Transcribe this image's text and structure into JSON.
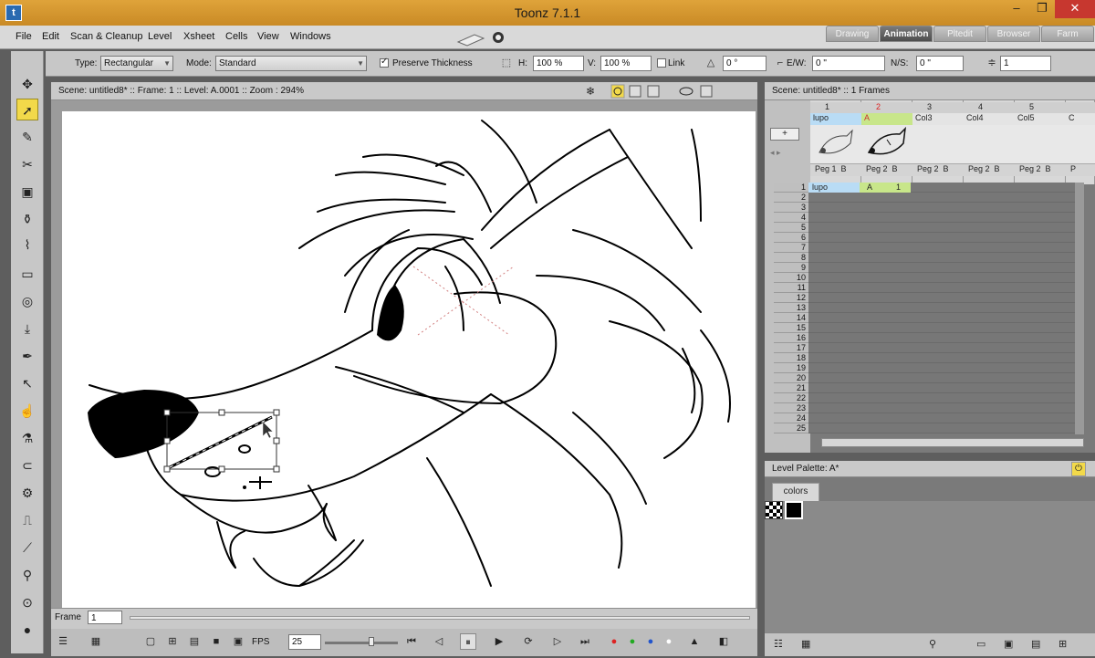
{
  "window": {
    "title": "Toonz 7.1.1",
    "minimize": "–",
    "maximize": "❐",
    "close": "✕"
  },
  "menu": [
    "File",
    "Edit",
    "Scan & Cleanup",
    "Level",
    "Xsheet",
    "Cells",
    "View",
    "Windows"
  ],
  "rooms": {
    "tabs": [
      "Drawing",
      "Animation",
      "Pltedit",
      "Browser",
      "Farm"
    ],
    "active": "Animation"
  },
  "tool_options": {
    "type_label": "Type:",
    "type_value": "Rectangular",
    "mode_label": "Mode:",
    "mode_value": "Standard",
    "preserve_thickness_label": "Preserve Thickness",
    "preserve_thickness_checked": true,
    "h_label": "H:",
    "h_value": "100 %",
    "v_label": "V:",
    "v_value": "100 %",
    "link_label": "Link",
    "angle_value": "0 °",
    "ew_label": "E/W:",
    "ew_value": "0 \"",
    "ns_label": "N/S:",
    "ns_value": "0 \"",
    "thickness_value": "1"
  },
  "viewer": {
    "header_text": "Scene: untitled8*  ::  Frame: 1  ::  Level: A.0001  ::  Zoom : 294%",
    "frame_label": "Frame",
    "frame_value": "1",
    "fps_label": "FPS",
    "fps_value": "25"
  },
  "xsheet": {
    "header_text": "Scene: untitled8*  ::  1 Frames",
    "columns": [
      {
        "num": "1",
        "name": "lupo",
        "peg": "Peg 1",
        "b": "B"
      },
      {
        "num": "2",
        "name": "A",
        "peg": "Peg 2",
        "b": "B"
      },
      {
        "num": "3",
        "name": "Col3",
        "peg": "Peg 2",
        "b": "B"
      },
      {
        "num": "4",
        "name": "Col4",
        "peg": "Peg 2",
        "b": "B"
      },
      {
        "num": "5",
        "name": "Col5",
        "peg": "Peg 2",
        "b": "B"
      },
      {
        "num": "",
        "name": "C",
        "peg": "P",
        "b": ""
      }
    ],
    "row1_cells": {
      "col1": "lupo",
      "col2": "A",
      "col2_frame": "1"
    },
    "rows": [
      "1",
      "2",
      "3",
      "4",
      "5",
      "6",
      "7",
      "8",
      "9",
      "10",
      "11",
      "12",
      "13",
      "14",
      "15",
      "16",
      "17",
      "18",
      "19",
      "20",
      "21",
      "22",
      "23",
      "24",
      "25"
    ]
  },
  "palette": {
    "header_text": "Level Palette: A*",
    "tab": "colors",
    "swatches": [
      "#000000"
    ]
  },
  "colors": {
    "titlebar": "#d4952e",
    "selected_tool": "#f2d94a",
    "xsheet_col2": "#c8e68a",
    "xsheet_col1": "#b9dcf5"
  }
}
